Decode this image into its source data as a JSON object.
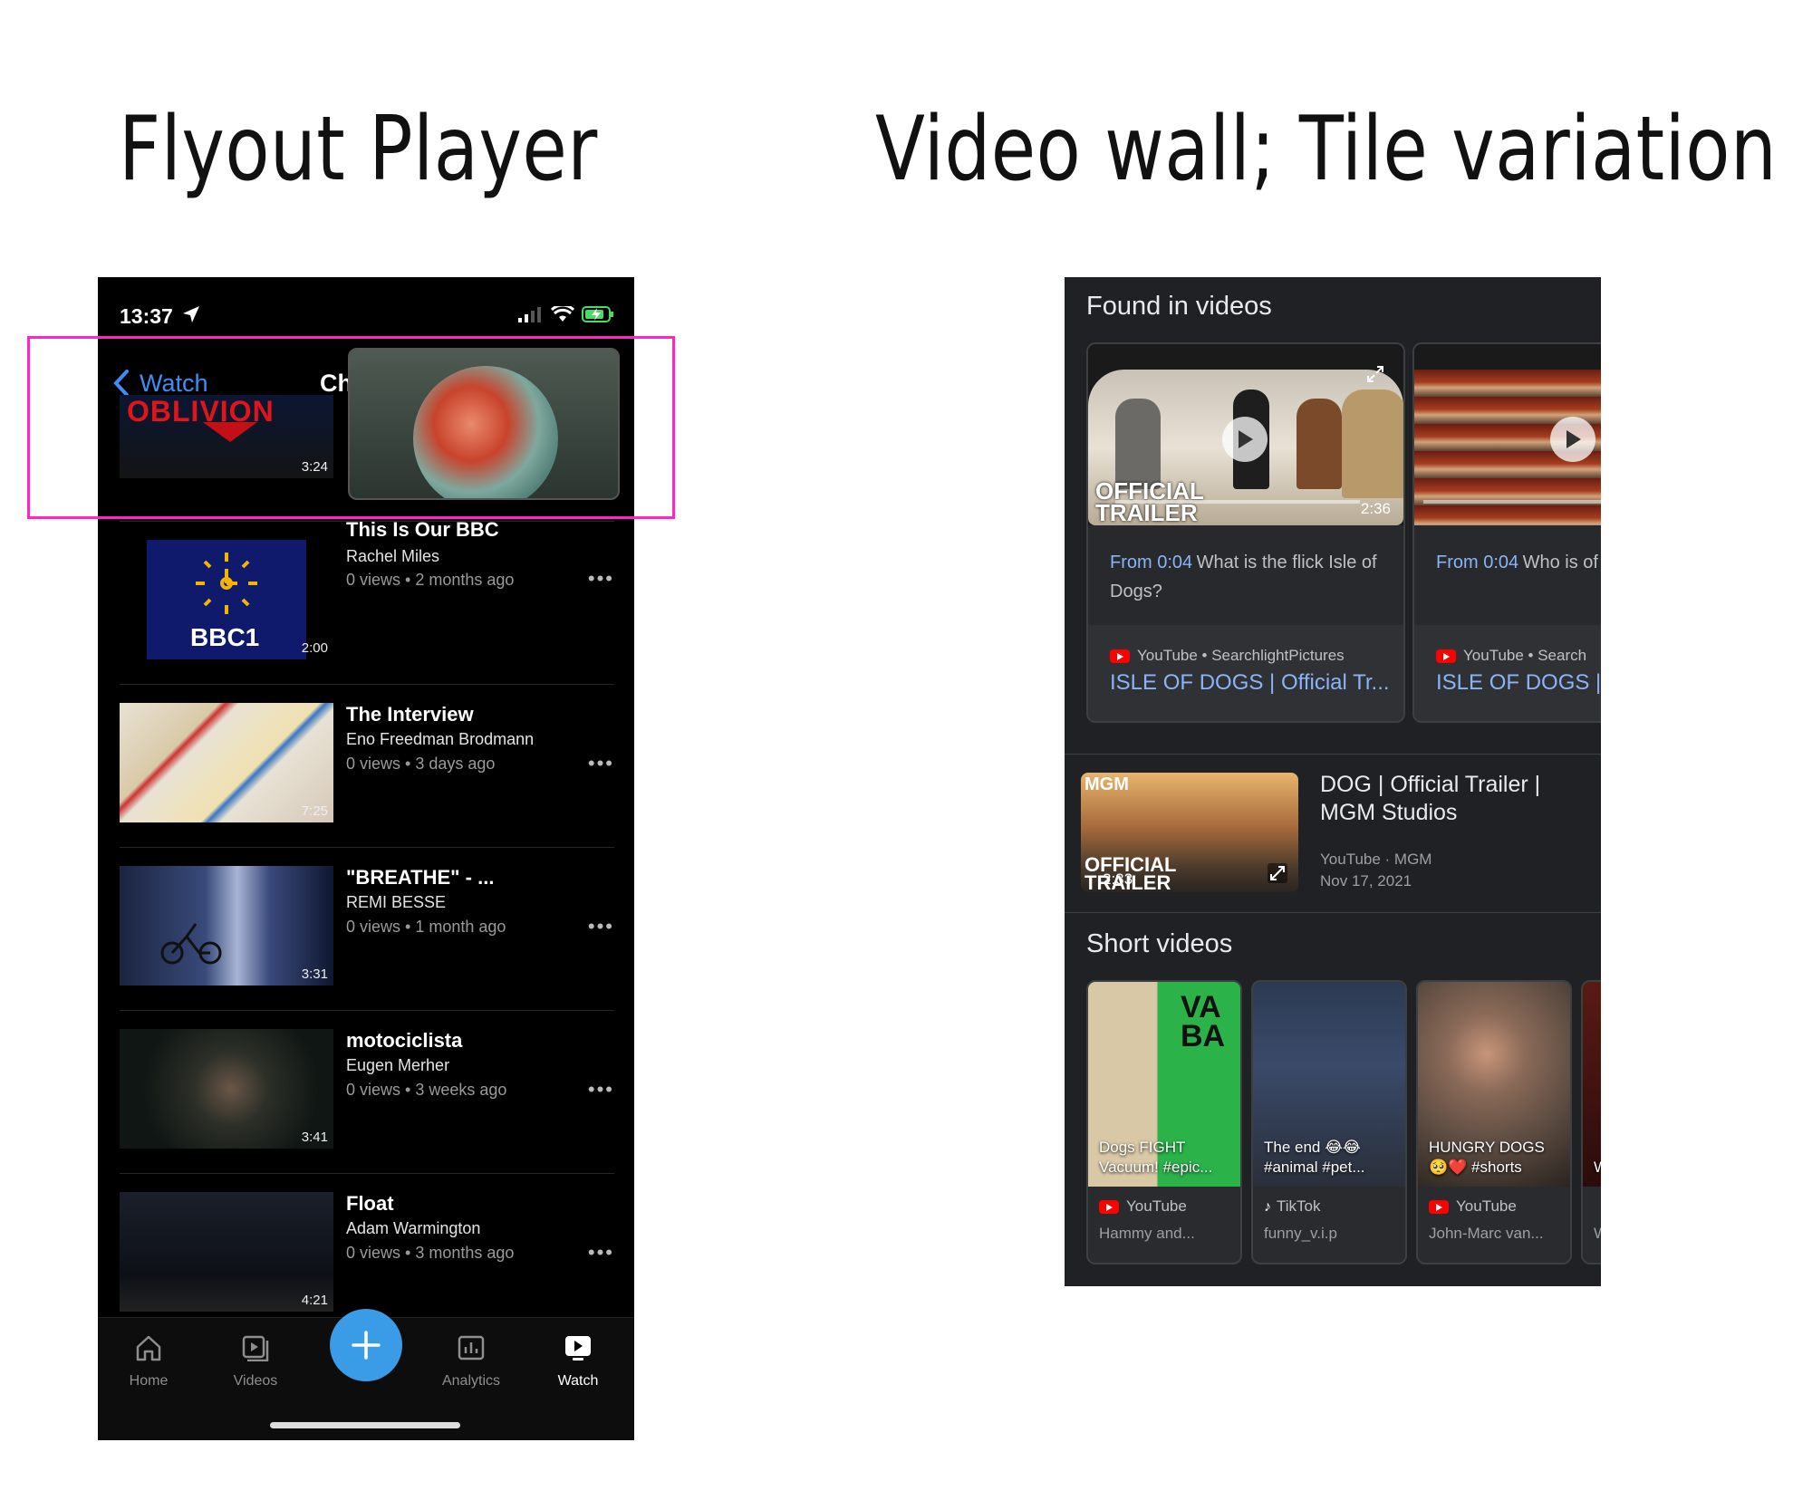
{
  "headings": {
    "left": "Flyout Player",
    "right": "Video wall; Tile variation"
  },
  "phone": {
    "status_time": "13:37",
    "nav_back_label": "Watch",
    "nav_title": "Ch",
    "partial_first_row": {
      "duration": "3:24",
      "thumb_text": "OBLIVION"
    },
    "videos": [
      {
        "title": "This Is Our BBC",
        "author": "Rachel Miles",
        "meta": "0 views • 2 months ago",
        "duration": "2:00",
        "thumb_text": "BBC1"
      },
      {
        "title": "The Interview",
        "author": "Eno Freedman Brodmann",
        "meta": "0 views • 3 days ago",
        "duration": "7:25"
      },
      {
        "title": "\"BREATHE\" -  ...",
        "author": "REMI BESSE",
        "meta": "0 views • 1 month ago",
        "duration": "3:31"
      },
      {
        "title": "motociclista",
        "author": "Eugen Merher",
        "meta": "0 views • 3 weeks ago",
        "duration": "3:41"
      },
      {
        "title": "Float",
        "author": "Adam Warmington",
        "meta": "0 views • 3 months ago",
        "duration": "4:21"
      }
    ],
    "more_glyph": "•••",
    "tabs": [
      {
        "label": "Home",
        "icon": "home-icon"
      },
      {
        "label": "Videos",
        "icon": "videos-icon"
      },
      {
        "label": "Analytics",
        "icon": "analytics-icon"
      },
      {
        "label": "Watch",
        "icon": "watch-icon",
        "active": true
      }
    ],
    "highlight_color": "#ff27c4",
    "accent_color": "#3e8ef7"
  },
  "google": {
    "found_title": "Found in videos",
    "found_cards": [
      {
        "duration": "2:36",
        "thumb_text": "OFFICIAL TRAILER",
        "from": "From 0:04",
        "question": "What is the flick Isle of Dogs?",
        "source": "YouTube • SearchlightPictures",
        "link": "ISLE OF DOGS | Official Tr..."
      },
      {
        "from": "From 0:04",
        "question": "Who is of Dogs?",
        "source": "YouTube • Search",
        "link": "ISLE OF DOGS |"
      }
    ],
    "dog_row": {
      "title": "DOG | Official Trailer | MGM Studios",
      "source": "YouTube · MGM",
      "date": "Nov 17, 2021",
      "duration": "2:33",
      "thumb_text_logo": "MGM",
      "thumb_text": "OFFICIAL TRAILER"
    },
    "short_title": "Short videos",
    "shorts": [
      {
        "caption": "Dogs FIGHT Vacuum! #epic...",
        "source": "YouTube",
        "author": "Hammy and...",
        "thumb_text": "VA BA"
      },
      {
        "caption": "The end 😂😂 #animal #pet...",
        "source": "TikTok",
        "author": "funny_v.i.p"
      },
      {
        "caption": "HUNGRY DOGS 🥺❤️ #shorts",
        "source": "YouTube",
        "author": "John-Marc van..."
      },
      {
        "caption": "W E",
        "source": "",
        "author": "W"
      }
    ],
    "link_color": "#8ab4f8"
  }
}
